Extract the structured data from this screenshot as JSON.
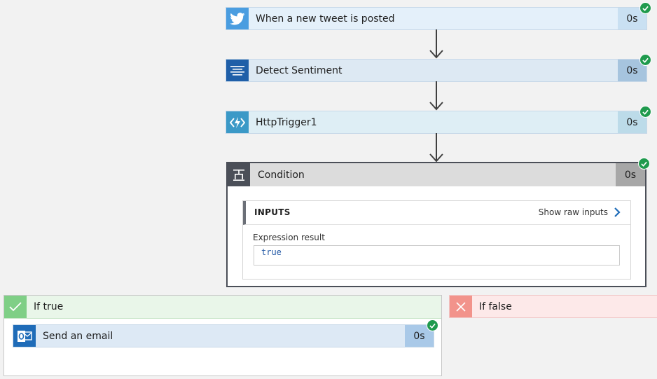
{
  "steps": [
    {
      "title": "When a new tweet is posted",
      "duration": "0s",
      "icon": "twitter-icon"
    },
    {
      "title": "Detect Sentiment",
      "duration": "0s",
      "icon": "text-lines-icon"
    },
    {
      "title": "HttpTrigger1",
      "duration": "0s",
      "icon": "azure-function-icon"
    }
  ],
  "condition": {
    "title": "Condition",
    "duration": "0s",
    "icon": "condition-icon",
    "inputs_label": "INPUTS",
    "show_raw_label": "Show raw inputs",
    "expression_label": "Expression result",
    "expression_value": "true"
  },
  "branch_true": {
    "title": "If true",
    "icon": "checkmark-icon",
    "action": {
      "title": "Send an email",
      "duration": "0s",
      "icon": "outlook-icon"
    }
  },
  "branch_false": {
    "title": "If false",
    "icon": "x-icon"
  },
  "colors": {
    "twitter_bg": "#e4f0fa",
    "twitter_icon": "#4a9de0",
    "twitter_dur": "#c9e0f2",
    "sentiment_bg": "#dde9f3",
    "sentiment_icon": "#1f5fa8",
    "sentiment_dur": "#a6c4de",
    "http_bg": "#deeef5",
    "http_icon": "#3b99c7",
    "http_dur": "#bcdbe9",
    "email_bg": "#dde9f5",
    "email_icon": "#1f6cb8",
    "email_dur": "#a9c9e8",
    "success": "#1f9a4d"
  }
}
